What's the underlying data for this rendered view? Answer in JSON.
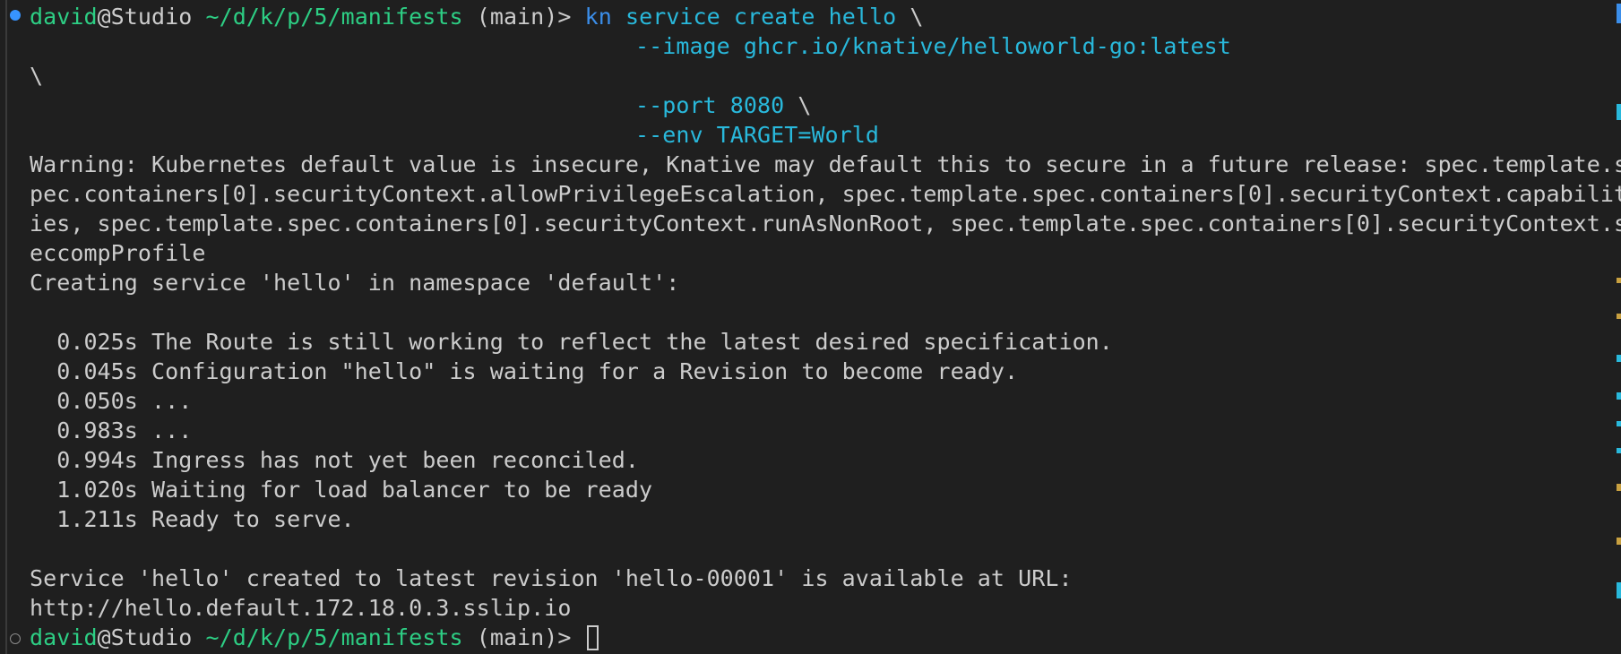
{
  "prompt": {
    "user": "david",
    "at": "@Studio",
    "path": "~/d/k/p/5/manifests",
    "branch": "(main)>"
  },
  "command": {
    "bin": "kn",
    "args": "service create hello",
    "cont": "\\",
    "image_flag": "--image ghcr.io/knative/helloworld-go:latest",
    "backslash_line": "\\",
    "port_flag": "--port 8080",
    "env_flag": "--env TARGET=World"
  },
  "output": {
    "warning": [
      "Warning: Kubernetes default value is insecure, Knative may default this to secure in a future release: spec.template.s",
      "pec.containers[0].securityContext.allowPrivilegeEscalation, spec.template.spec.containers[0].securityContext.capabilit",
      "ies, spec.template.spec.containers[0].securityContext.runAsNonRoot, spec.template.spec.containers[0].securityContext.s",
      "eccompProfile"
    ],
    "creating": "Creating service 'hello' in namespace 'default':",
    "steps": [
      "  0.025s The Route is still working to reflect the latest desired specification.",
      "  0.045s Configuration \"hello\" is waiting for a Revision to become ready.",
      "  0.050s ...",
      "  0.983s ...",
      "  0.994s Ingress has not yet been reconciled.",
      "  1.020s Waiting for load balancer to be ready",
      "  1.211s Ready to serve."
    ],
    "created": "Service 'hello' created to latest revision 'hello-00001' is available at URL:",
    "url": "http://hello.default.172.18.0.3.sslip.io"
  },
  "colors": {
    "background": "#1f1f1f",
    "text": "#cccccc",
    "prompt_green": "#2dce84",
    "command_blue": "#3b8eea",
    "arg_cyan": "#29b8db"
  }
}
